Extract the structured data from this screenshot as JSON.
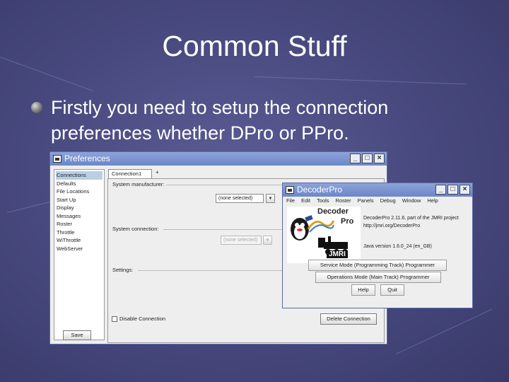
{
  "slide": {
    "title": "Common Stuff",
    "bullet": "Firstly you need to setup the connection preferences whether DPro or PPro."
  },
  "preferences_window": {
    "title": "Preferences",
    "categories": [
      "Connections",
      "Defaults",
      "File Locations",
      "Start Up",
      "Display",
      "Messages",
      "Roster",
      "Throttle",
      "WiThrottle",
      "WebServer"
    ],
    "tab_label": "Connection1",
    "tab_add": "+",
    "system_manufacturer_label": "System manufacturer:",
    "system_manufacturer_value": "(none selected)",
    "system_connection_label": "System connection:",
    "system_connection_value": "(none selected)",
    "settings_label": "Settings:",
    "disable_connection_label": "Disable Connection",
    "delete_connection_button": "Delete Connection",
    "save_button": "Save"
  },
  "decoderpro_window": {
    "title": "DecoderPro",
    "menu": [
      "File",
      "Edit",
      "Tools",
      "Roster",
      "Panels",
      "Debug",
      "Window",
      "Help"
    ],
    "logo_line1": "Decoder",
    "logo_line2": "Pro",
    "logo_badge": "JMRI",
    "version_line": "DecoderPro 2.11.6, part of the JMRI project",
    "url_line": "http://jmri.org/DecoderPro",
    "java_line": "Java version 1.6.0_24 (en_GB)",
    "service_mode_button": "Service Mode (Programming Track) Programmer",
    "ops_mode_button": "Operations Mode (Main Track) Programmer",
    "help_button": "Help",
    "quit_button": "Quit"
  },
  "window_controls": {
    "minimize": "_",
    "maximize": "□",
    "close": "×"
  },
  "colors": {
    "background": "#46477c",
    "titlebar": "#7a93d1",
    "list_selection": "#b8cfe5"
  }
}
